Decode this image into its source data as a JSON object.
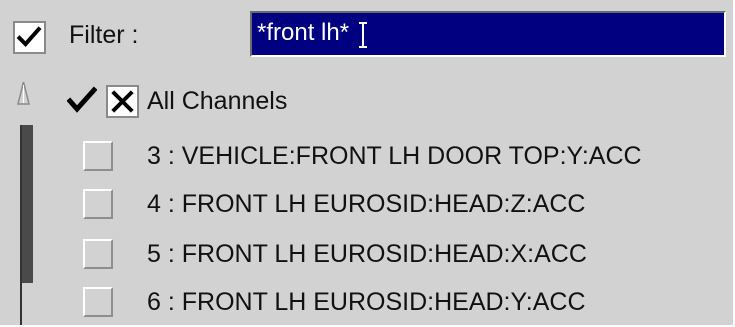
{
  "filter": {
    "label": "Filter :",
    "value": "*front lh*",
    "enabled": true
  },
  "all_channels": {
    "label": "All Channels",
    "select_all_icon": "check-icon",
    "deselect_all_icon": "x-icon"
  },
  "channels": [
    {
      "label": "3 : VEHICLE:FRONT LH DOOR TOP:Y:ACC",
      "checked": false
    },
    {
      "label": "4 : FRONT LH EUROSID:HEAD:Z:ACC",
      "checked": false
    },
    {
      "label": "5 : FRONT LH EUROSID:HEAD:X:ACC",
      "checked": false
    },
    {
      "label": "6 : FRONT LH EUROSID:HEAD:Y:ACC",
      "checked": false
    }
  ],
  "scrollbar": {
    "up_icon": "scroll-up-arrow-icon"
  },
  "colors": {
    "panel_background": "#d2d2d2",
    "input_background": "#000080",
    "input_text": "#ffffff"
  }
}
